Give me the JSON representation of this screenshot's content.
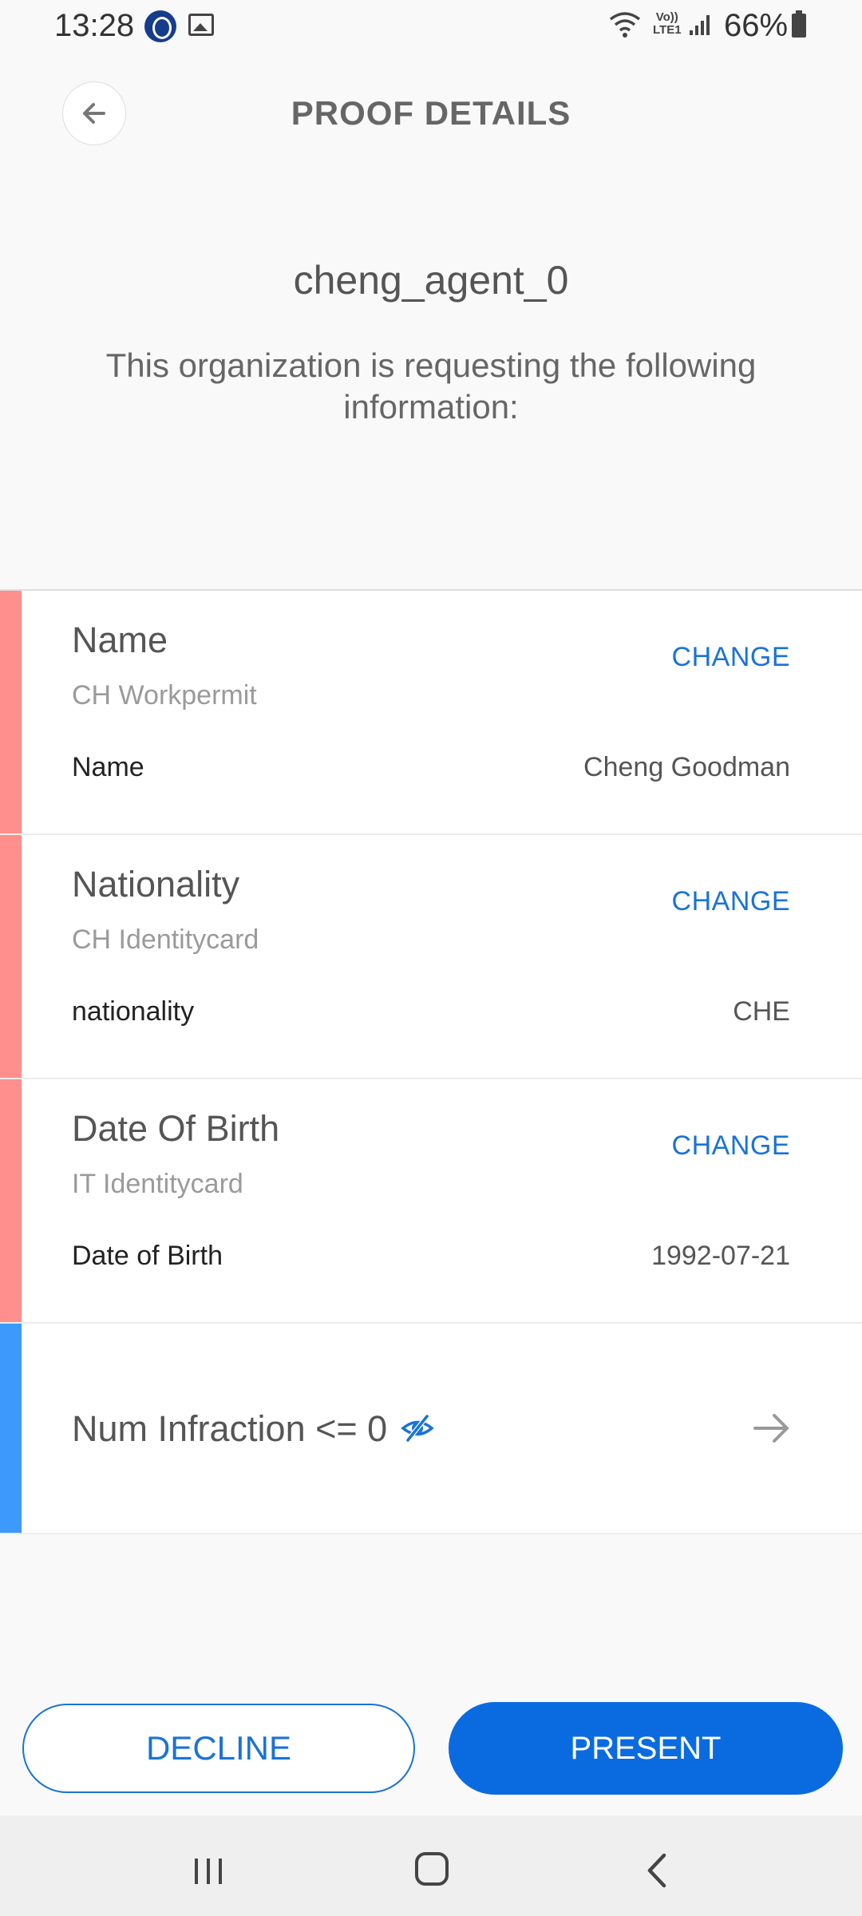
{
  "status_bar": {
    "time": "13:28",
    "volte_line1": "Vo))",
    "volte_line2": "LTE1",
    "battery": "66%",
    "icons": [
      "fingerprint-app-icon",
      "gallery-icon",
      "wifi-icon",
      "volte-icon",
      "signal-icon",
      "battery-icon"
    ]
  },
  "header": {
    "title": "PROOF DETAILS",
    "back_icon": "arrow-left-icon"
  },
  "request": {
    "organization": "cheng_agent_0",
    "description": "This organization is requesting the following information:"
  },
  "attributes": [
    {
      "title": "Name",
      "source": "CH Workpermit",
      "change_label": "CHANGE",
      "field_label": "Name",
      "field_value": "Cheng Goodman"
    },
    {
      "title": "Nationality",
      "source": "CH Identitycard",
      "change_label": "CHANGE",
      "field_label": "nationality",
      "field_value": "CHE"
    },
    {
      "title": "Date Of Birth",
      "source": "IT Identitycard",
      "change_label": "CHANGE",
      "field_label": "Date of Birth",
      "field_value": "1992-07-21"
    }
  ],
  "predicate": {
    "text": "Num Infraction <= 0",
    "icon": "eye-hidden-icon",
    "arrow_icon": "arrow-right-icon"
  },
  "actions": {
    "decline": "DECLINE",
    "present": "PRESENT"
  },
  "colors": {
    "accent": "#1a73d6",
    "primary_button": "#0a6be0",
    "attribute_bar": "#ff8f8c",
    "predicate_bar": "#3d99fb"
  },
  "nav_bar": {
    "icons": [
      "recent-apps-icon",
      "home-icon",
      "back-icon"
    ]
  }
}
